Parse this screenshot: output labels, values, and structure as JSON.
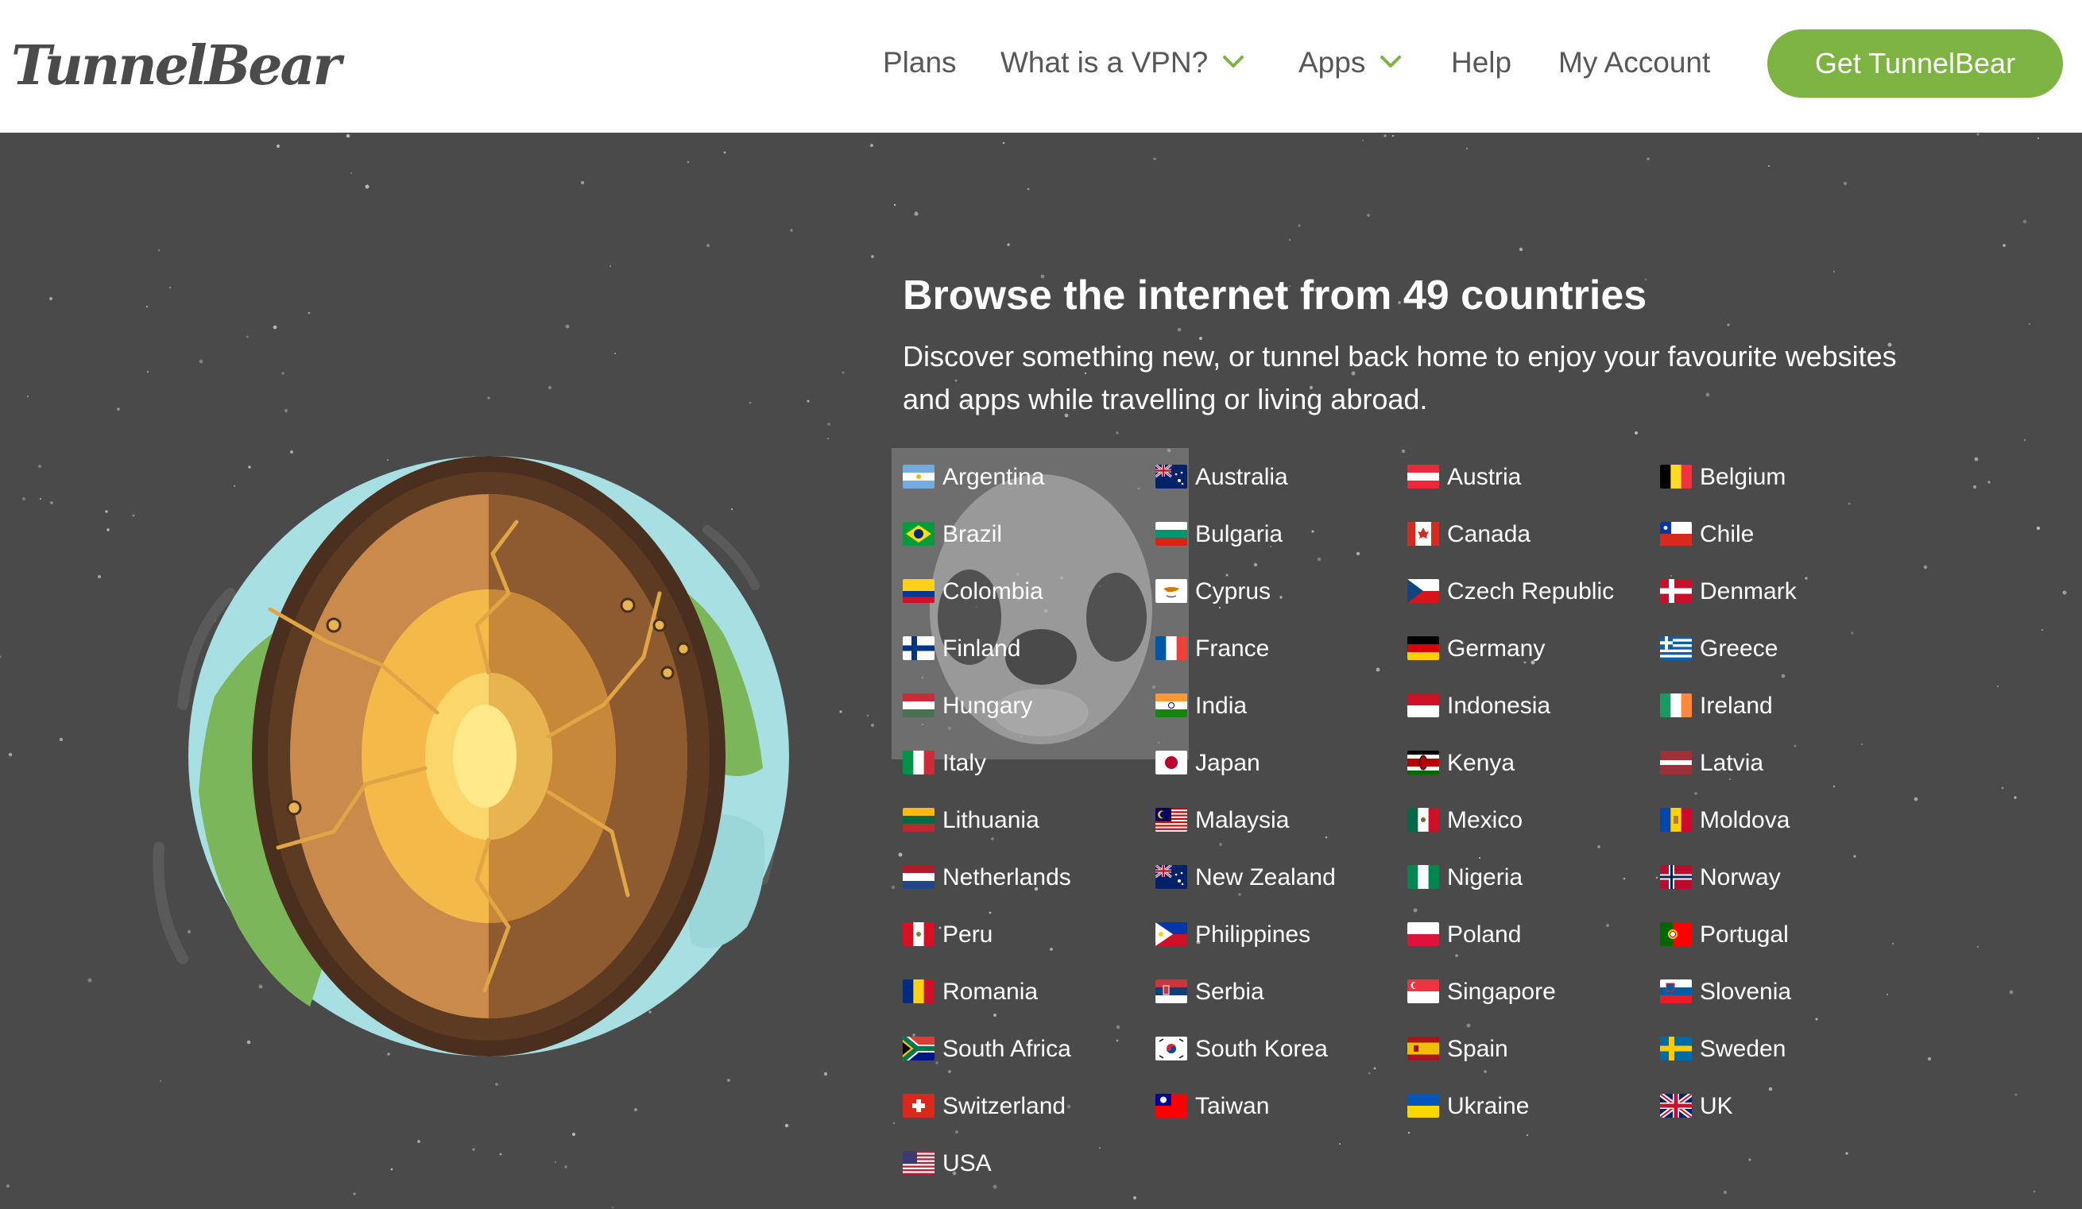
{
  "header": {
    "logo_text": "TunnelBear",
    "nav": {
      "plans": "Plans",
      "what_is_vpn": "What is a VPN?",
      "apps": "Apps",
      "help": "Help",
      "my_account": "My Account"
    },
    "cta_label": "Get TunnelBear",
    "dropdown_icon": "chevron-down-icon",
    "accent_color": "#7cb342"
  },
  "hero": {
    "headline": "Browse the internet from 49 countries",
    "subtext": "Discover something new, or tunnel back home to enjoy your favourite websites and apps while travelling or living abroad."
  },
  "countries": [
    "Argentina",
    "Australia",
    "Austria",
    "Belgium",
    "Brazil",
    "Bulgaria",
    "Canada",
    "Chile",
    "Colombia",
    "Cyprus",
    "Czech Republic",
    "Denmark",
    "Finland",
    "France",
    "Germany",
    "Greece",
    "Hungary",
    "India",
    "Indonesia",
    "Ireland",
    "Italy",
    "Japan",
    "Kenya",
    "Latvia",
    "Lithuania",
    "Malaysia",
    "Mexico",
    "Moldova",
    "Netherlands",
    "New Zealand",
    "Nigeria",
    "Norway",
    "Peru",
    "Philippines",
    "Poland",
    "Portugal",
    "Romania",
    "Serbia",
    "Singapore",
    "Slovenia",
    "South Africa",
    "South Korea",
    "Spain",
    "Sweden",
    "Switzerland",
    "Taiwan",
    "Ukraine",
    "UK",
    "USA"
  ],
  "background_color": "#4a4a4a"
}
